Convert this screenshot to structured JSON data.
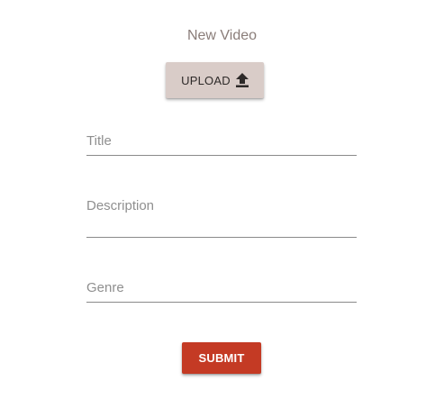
{
  "form": {
    "title": "New Video",
    "upload_label": "UPLOAD",
    "upload_icon": "upload-arrow-icon",
    "fields": {
      "title": {
        "label": "Title",
        "value": ""
      },
      "description": {
        "label": "Description",
        "value": ""
      },
      "genre": {
        "label": "Genre",
        "value": ""
      }
    },
    "submit_label": "SUBMIT"
  },
  "colors": {
    "upload_button_bg": "#d9ccc8",
    "submit_button_bg": "#c43a24",
    "title_text": "#8a7d79",
    "label_text": "#8f8f8f",
    "underline": "#8a8a8a"
  }
}
